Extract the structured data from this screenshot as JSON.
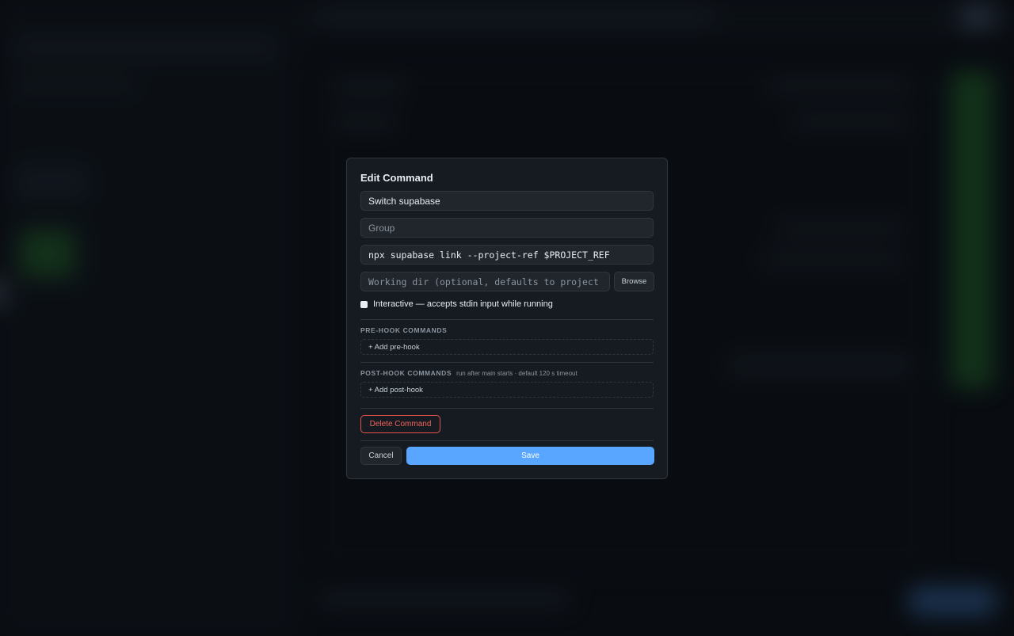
{
  "modal": {
    "title": "Edit Command",
    "name_value": "Switch supabase",
    "group_placeholder": "Group",
    "command_value": "npx supabase link --project-ref $PROJECT_REF",
    "workdir_placeholder": "Working dir (optional, defaults to project path)",
    "browse_label": "Browse",
    "interactive_label": "Interactive — accepts stdin input while running",
    "interactive_checked": true,
    "pre_hook": {
      "label": "PRE-HOOK COMMANDS",
      "add_label": "+ Add pre-hook"
    },
    "post_hook": {
      "label": "POST-HOOK COMMANDS",
      "hint": "run after main starts · default 120 s timeout",
      "add_label": "+ Add post-hook"
    },
    "delete_label": "Delete Command",
    "cancel_label": "Cancel",
    "save_label": "Save"
  },
  "colors": {
    "accent": "#58a6ff",
    "danger": "#e5534b",
    "surface": "#161b22",
    "border": "#30363d"
  }
}
